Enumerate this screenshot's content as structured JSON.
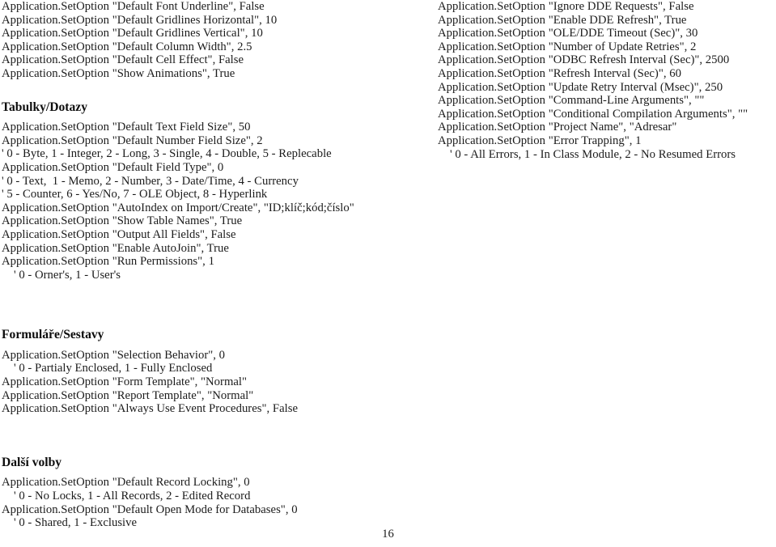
{
  "page": {
    "number": "16",
    "background_color": "#ffffff",
    "text_color": "#1b1b1b"
  },
  "left_column": {
    "intro_lines": [
      "Application.SetOption \"Default Font Underline\", False",
      "Application.SetOption \"Default Gridlines Horizontal\", 10",
      "Application.SetOption \"Default Gridlines Vertical\", 10",
      "Application.SetOption \"Default Column Width\", 2.5",
      "Application.SetOption \"Default Cell Effect\", False",
      "Application.SetOption \"Show Animations\", True"
    ],
    "sections": [
      {
        "heading": "Tabulky/Dotazy",
        "lines": [
          {
            "text": "Application.SetOption \"Default Text Field Size\", 50",
            "indent": false
          },
          {
            "text": "Application.SetOption \"Default Number Field Size\", 2",
            "indent": false
          },
          {
            "text": "' 0 - Byte, 1 - Integer, 2 - Long, 3 - Single, 4 - Double, 5 - Replecable",
            "indent": false
          },
          {
            "text": "Application.SetOption \"Default Field Type\", 0",
            "indent": false
          },
          {
            "text": "' 0 - Text,  1 - Memo, 2 - Number, 3 - Date/Time, 4 - Currency",
            "indent": false
          },
          {
            "text": "' 5 - Counter, 6 - Yes/No, 7 - OLE Object, 8 - Hyperlink",
            "indent": false
          },
          {
            "text": "Application.SetOption \"AutoIndex on Import/Create\", \"ID;klíč;kód;číslo\"",
            "indent": false
          },
          {
            "text": "Application.SetOption \"Show Table Names\", True",
            "indent": false
          },
          {
            "text": "Application.SetOption \"Output All Fields\", False",
            "indent": false
          },
          {
            "text": "Application.SetOption \"Enable AutoJoin\", True",
            "indent": false
          },
          {
            "text": "Application.SetOption \"Run Permissions\", 1",
            "indent": false
          },
          {
            "text": "' 0 - Orner's, 1 - User's",
            "indent": true
          }
        ]
      },
      {
        "heading": "Formuláře/Sestavy",
        "lines": [
          {
            "text": "Application.SetOption \"Selection Behavior\", 0",
            "indent": false
          },
          {
            "text": "' 0 - Partialy Enclosed, 1 - Fully Enclosed",
            "indent": true
          },
          {
            "text": "Application.SetOption \"Form Template\", \"Normal\"",
            "indent": false
          },
          {
            "text": "Application.SetOption \"Report Template\", \"Normal\"",
            "indent": false
          },
          {
            "text": "Application.SetOption \"Always Use Event Procedures\", False",
            "indent": false
          }
        ]
      },
      {
        "heading": "Další volby",
        "lines": [
          {
            "text": "Application.SetOption \"Default Record Locking\", 0",
            "indent": false
          },
          {
            "text": "' 0 - No Locks, 1 - All Records, 2 - Edited Record",
            "indent": true
          },
          {
            "text": "Application.SetOption \"Default Open Mode for Databases\", 0",
            "indent": false
          },
          {
            "text": "' 0 - Shared, 1 - Exclusive",
            "indent": true
          }
        ]
      }
    ]
  },
  "right_column": {
    "lines": [
      {
        "text": "Application.SetOption \"Ignore DDE Requests\", False",
        "indent": false
      },
      {
        "text": "Application.SetOption \"Enable DDE Refresh\", True",
        "indent": false
      },
      {
        "text": "Application.SetOption \"OLE/DDE Timeout (Sec)\", 30",
        "indent": false
      },
      {
        "text": "Application.SetOption \"Number of Update Retries\", 2",
        "indent": false
      },
      {
        "text": "Application.SetOption \"ODBC Refresh Interval (Sec)\", 2500",
        "indent": false
      },
      {
        "text": "Application.SetOption \"Refresh Interval (Sec)\", 60",
        "indent": false
      },
      {
        "text": "Application.SetOption \"Update Retry Interval (Msec)\", 250",
        "indent": false
      },
      {
        "text": "Application.SetOption \"Command-Line Arguments\", \"\"",
        "indent": false
      },
      {
        "text": "Application.SetOption \"Conditional Compilation Arguments\", \"\"",
        "indent": false
      },
      {
        "text": "Application.SetOption \"Project Name\", \"Adresar\"",
        "indent": false
      },
      {
        "text": "Application.SetOption \"Error Trapping\", 1",
        "indent": false
      },
      {
        "text": "' 0 - All Errors, 1 - In Class Module, 2 - No Resumed Errors",
        "indent": true
      }
    ]
  }
}
